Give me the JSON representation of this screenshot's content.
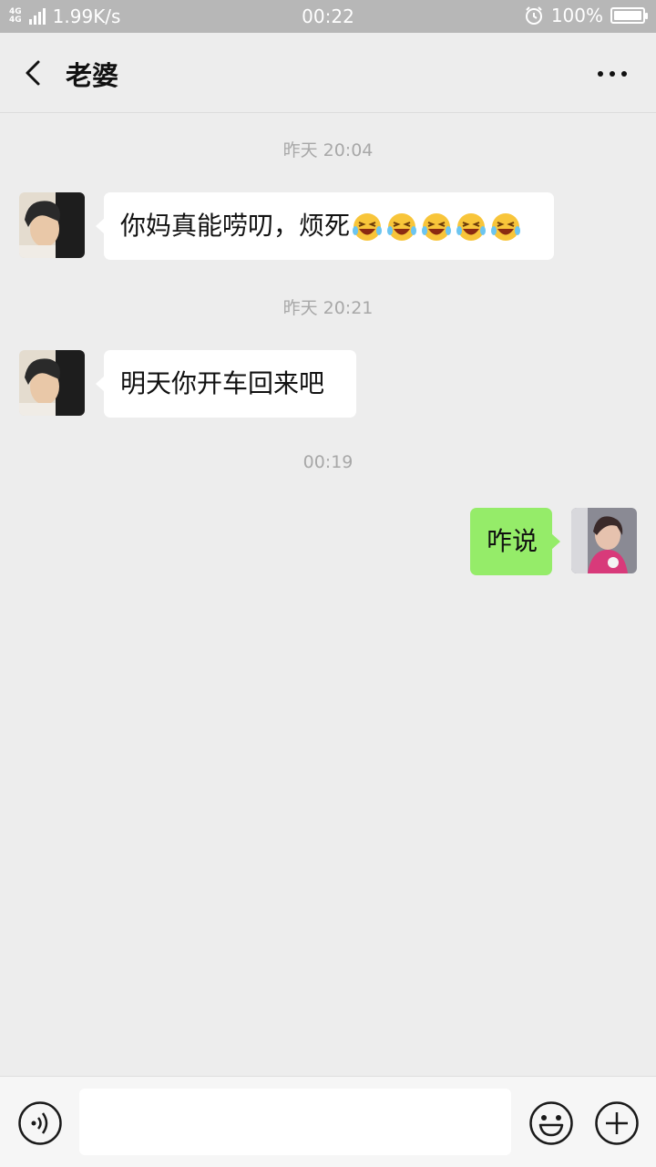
{
  "status_bar": {
    "network_top": "4G",
    "network_bottom": "4G",
    "speed": "1.99K/s",
    "time": "00:22",
    "battery": "100%",
    "battery_level": 1.0,
    "icons": [
      "signal-icon",
      "alarm-icon",
      "battery-icon"
    ]
  },
  "header": {
    "title": "老婆",
    "back_icon": "chevron-left-icon",
    "more_icon": "more-icon"
  },
  "messages": [
    {
      "timestamp": "昨天 20:04",
      "sender": "contact",
      "text": "你妈真能唠叨，烦死",
      "emoji": [
        "laughing-emoji",
        "laughing-emoji",
        "laughing-emoji",
        "laughing-emoji",
        "laughing-emoji"
      ]
    },
    {
      "timestamp": "昨天 20:21",
      "sender": "contact",
      "text": "明天你开车回来吧"
    },
    {
      "timestamp": "00:19",
      "sender": "me",
      "text": "咋说"
    }
  ],
  "input_bar": {
    "value": "",
    "icons": [
      "voice-icon",
      "emoji-icon",
      "plus-icon"
    ]
  },
  "colors": {
    "background": "#ededed",
    "incoming_bubble": "#ffffff",
    "outgoing_bubble": "#95ec69",
    "status_bar": "#b7b7b7",
    "timestamp": "#a8a8a8"
  }
}
